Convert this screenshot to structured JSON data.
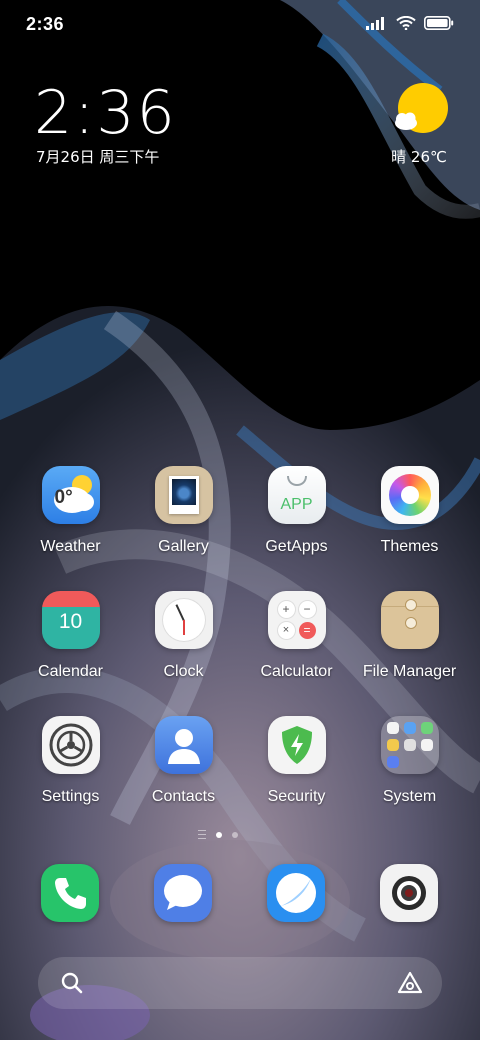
{
  "status_bar": {
    "time": "2:36",
    "icons": [
      "signal-icon",
      "wifi-icon",
      "battery-icon"
    ]
  },
  "clock_widget": {
    "time": "2:36",
    "date": "7月26日 周三下午"
  },
  "weather_widget": {
    "condition_icon": "sun-cloud-icon",
    "text": "晴 26℃"
  },
  "apps": [
    {
      "label": "Weather",
      "icon": "weather-icon",
      "badge_text": "0°"
    },
    {
      "label": "Gallery",
      "icon": "gallery-icon"
    },
    {
      "label": "GetApps",
      "icon": "getapps-icon",
      "badge_text": "APP"
    },
    {
      "label": "Themes",
      "icon": "themes-icon"
    },
    {
      "label": "Calendar",
      "icon": "calendar-icon",
      "badge_text": "10"
    },
    {
      "label": "Clock",
      "icon": "clock-icon"
    },
    {
      "label": "Calculator",
      "icon": "calculator-icon"
    },
    {
      "label": "File Manager",
      "icon": "file-manager-icon"
    },
    {
      "label": "Settings",
      "icon": "settings-icon"
    },
    {
      "label": "Contacts",
      "icon": "contacts-icon"
    },
    {
      "label": "Security",
      "icon": "security-icon"
    },
    {
      "label": "System",
      "icon": "folder-icon"
    }
  ],
  "page_indicator": {
    "pages": 2,
    "active_page": 1
  },
  "dock": [
    {
      "icon": "phone-icon"
    },
    {
      "icon": "messages-icon"
    },
    {
      "icon": "browser-icon"
    },
    {
      "icon": "camera-icon"
    }
  ],
  "search_bar": {
    "left_icon": "search-icon",
    "right_icon": "assistant-icon"
  },
  "colors": {
    "phone": "#27c46a",
    "messages": "#4f7fe6",
    "browser": "#2a8ff0",
    "calendar_top": "#f05a5a",
    "calendar_bottom": "#2fb4a3",
    "security": "#4cbb4e",
    "weather_sky": "#3a8df0",
    "sun": "#ffcc00"
  }
}
